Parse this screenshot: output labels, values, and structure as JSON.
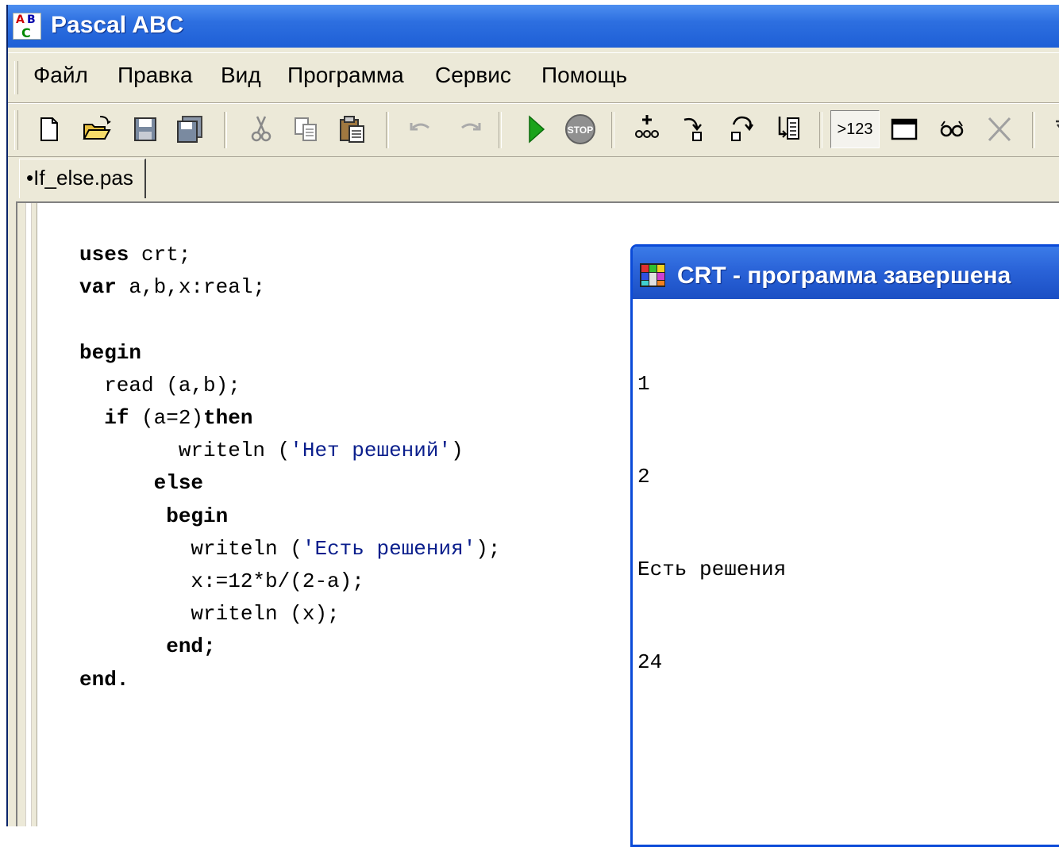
{
  "window": {
    "title": "Pascal ABC",
    "icon_letters": [
      "A",
      "B",
      "C"
    ]
  },
  "menu": {
    "items": [
      "Файл",
      "Правка",
      "Вид",
      "Программа",
      "Сервис",
      "Помощь"
    ]
  },
  "toolbar": {
    "buttons": [
      "new-file-icon",
      "open-folder-icon",
      "save-icon",
      "save-all-icon",
      "cut-icon",
      "copy-icon",
      "paste-icon",
      "undo-icon",
      "redo-icon",
      "run-icon",
      "stop-icon",
      "trace-into-icon",
      "step-into-icon",
      "step-over-icon",
      "run-to-cursor-icon",
      "evaluate-icon",
      "output-window-icon",
      "watch-icon",
      "delete-icon"
    ],
    "evaluate_label": ">123",
    "stop_label": "STOP"
  },
  "tabs": [
    {
      "label": "•If_else.pas",
      "active": true
    }
  ],
  "editor": {
    "lines": [
      [
        {
          "t": "uses",
          "k": "kw"
        },
        {
          "t": " crt;"
        }
      ],
      [
        {
          "t": "var",
          "k": "kw"
        },
        {
          "t": " a,b,x:real;"
        }
      ],
      [],
      [
        {
          "t": "begin",
          "k": "kw"
        }
      ],
      [
        {
          "t": "  read (a,b);"
        }
      ],
      [
        {
          "t": "  "
        },
        {
          "t": "if",
          "k": "kw"
        },
        {
          "t": " (a=2)"
        },
        {
          "t": "then",
          "k": "kw"
        }
      ],
      [
        {
          "t": "        writeln ("
        },
        {
          "t": "'Нет решений'",
          "k": "str"
        },
        {
          "t": ")"
        }
      ],
      [
        {
          "t": "      "
        },
        {
          "t": "else",
          "k": "kw"
        }
      ],
      [
        {
          "t": "       "
        },
        {
          "t": "begin",
          "k": "kw"
        }
      ],
      [
        {
          "t": "         writeln ("
        },
        {
          "t": "'Есть решения'",
          "k": "str"
        },
        {
          "t": ");"
        }
      ],
      [
        {
          "t": "         x:=12*b/(2-a);"
        }
      ],
      [
        {
          "t": "         writeln (x);"
        }
      ],
      [
        {
          "t": "       "
        },
        {
          "t": "end;",
          "k": "kw"
        }
      ],
      [
        {
          "t": "end.",
          "k": "kw"
        }
      ]
    ]
  },
  "crt": {
    "title": "CRT - программа завершена",
    "output": [
      "1",
      "2",
      "Есть решения",
      "24"
    ]
  },
  "colors": {
    "titlebar": "#2d6fe0",
    "chrome": "#ece9d8",
    "string_literal": "#0a1e8c",
    "run_green": "#1ba31b"
  }
}
